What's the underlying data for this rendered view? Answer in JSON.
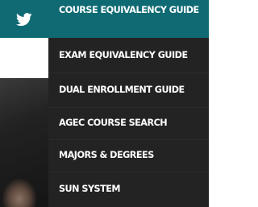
{
  "social": {
    "twitter_icon": "twitter-icon"
  },
  "colors": {
    "accent": "#0f6a73",
    "menu_bg": "#121212",
    "text": "#ffffff"
  },
  "menu": {
    "items": [
      {
        "label": "COURSE EQUIVALENCY GUIDE"
      },
      {
        "label": "EXAM EQUIVALENCY GUIDE"
      },
      {
        "label": "DUAL ENROLLMENT GUIDE"
      },
      {
        "label": "AGEC COURSE SEARCH"
      },
      {
        "label": "MAJORS & DEGREES"
      },
      {
        "label": "SUN SYSTEM"
      }
    ]
  }
}
